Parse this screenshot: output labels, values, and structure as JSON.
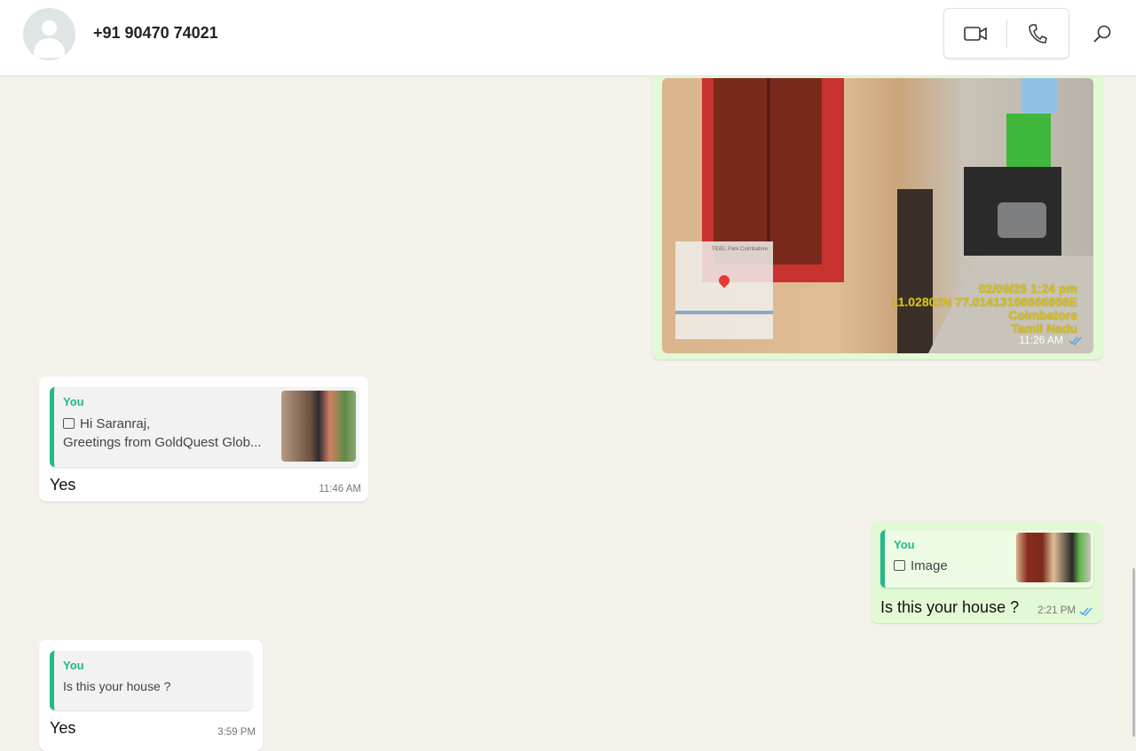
{
  "header": {
    "contact": "+91 90470 74021"
  },
  "image_message": {
    "stamp_datetime": "02/09/25 1:24 pm",
    "stamp_coords": "11.02802N 77.01413166666666E",
    "stamp_city": "Coimbatore",
    "stamp_state": "Tamil Nadu",
    "map_label": "TIDEL Park Coimbatore",
    "time": "11:26 AM"
  },
  "messages": [
    {
      "quote_author": "You",
      "quote_text_1": "Hi Saranraj,",
      "quote_text_2": "Greetings from GoldQuest Glob...",
      "text": "Yes",
      "time": "11:46 AM"
    },
    {
      "quote_author": "You",
      "quote_text": "Image",
      "text": "Is this your house ?",
      "time": "2:21 PM"
    },
    {
      "quote_author": "You",
      "quote_text": "Is this your house ?",
      "text": "Yes",
      "time": "3:59 PM"
    }
  ],
  "colors": {
    "accent": "#1fb88c",
    "outgoing": "#e2f9d5",
    "tick": "#53a6e8"
  }
}
